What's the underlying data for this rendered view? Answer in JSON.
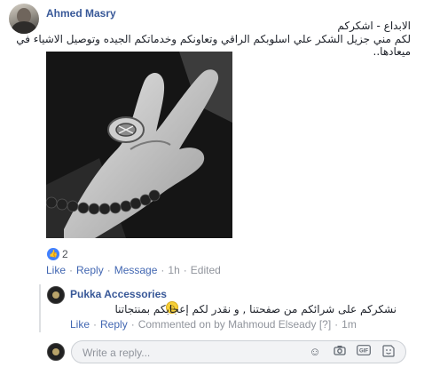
{
  "comment": {
    "author": "Ahmed Masry",
    "text_line1": "الابداع - اشكركم",
    "text_line2": "لكم مني جزيل الشكر علي اسلوبكم الراقي وتعاونكم وخدماتكم الجيده وتوصيل الاشياء في ميعادها..",
    "like_count": "2",
    "actions": {
      "like": "Like",
      "reply": "Reply",
      "message": "Message"
    },
    "time": "1h",
    "edited": "Edited"
  },
  "reply": {
    "author": "Pukka Accessories",
    "text": "نشكركم على شرائكم من صفحتنا , و نقدر لكم إعجابكم بمنتجاتنا",
    "actions": {
      "like": "Like",
      "reply": "Reply"
    },
    "commented_on": "Commented on by Mahmoud Elseady",
    "help": "[?]",
    "time": "1m"
  },
  "reply_box": {
    "placeholder": "Write a reply..."
  },
  "icons": {
    "like_badge": "thumbs-up-icon",
    "emoji": "smiling-face-icon",
    "reply_tools": [
      "emoji-icon",
      "camera-icon",
      "gif-icon",
      "sticker-icon"
    ]
  },
  "colors": {
    "link": "#4267b2",
    "author": "#385898",
    "muted": "#90949c",
    "like_badge": "#4080ff"
  }
}
